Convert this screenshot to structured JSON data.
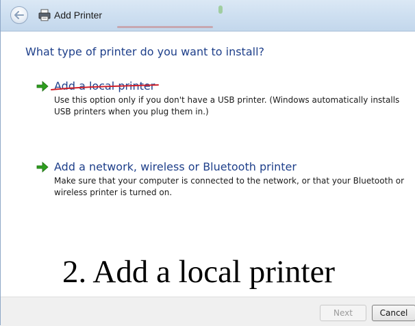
{
  "window": {
    "title": "Add Printer"
  },
  "main": {
    "heading": "What type of printer do you want to install?",
    "options": [
      {
        "title": "Add a local printer",
        "description": "Use this option only if you don't have a USB printer. (Windows automatically installs USB printers when you plug them in.)"
      },
      {
        "title": "Add a network, wireless or Bluetooth printer",
        "description": "Make sure that your computer is connected to the network, or that your Bluetooth or wireless printer is turned on."
      }
    ],
    "annotation": "2. Add a local printer"
  },
  "footer": {
    "next_label": "Next",
    "cancel_label": "Cancel"
  },
  "colors": {
    "heading": "#1e3f8a",
    "arrow_green": "#2e9e1f",
    "underline_red": "#d0202a"
  },
  "icons": {
    "back": "back-arrow-icon",
    "title": "printer-icon",
    "option": "green-arrow-icon"
  }
}
